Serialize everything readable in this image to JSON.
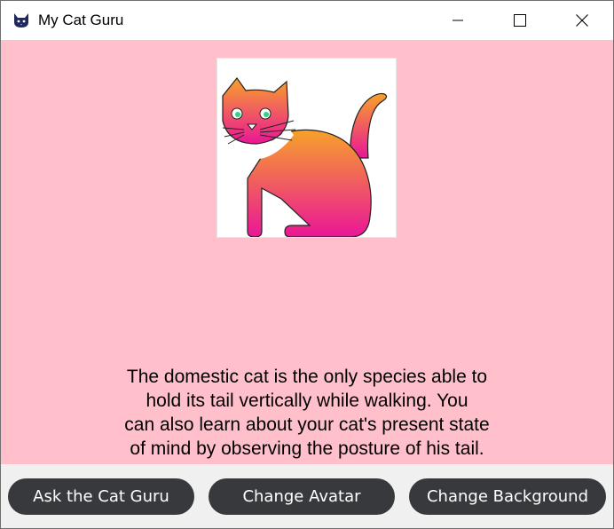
{
  "window": {
    "title": "My Cat Guru",
    "app_icon": "cat-face-icon",
    "controls": [
      "minimize-icon",
      "maximize-icon",
      "close-icon"
    ]
  },
  "colors": {
    "background": "#ffc0cb",
    "button": "#37393c",
    "button_text": "#ffffff",
    "cat_gradient_top": "#f7a22a",
    "cat_gradient_bottom": "#ea1697"
  },
  "avatar": {
    "icon": "orange-pink-cat-avatar"
  },
  "fact": {
    "text": "The domestic cat is the only species able to\nhold its tail vertically while walking. You\ncan also learn about your cat's present state\nof mind by observing the posture of his tail."
  },
  "buttons": {
    "ask": "Ask the Cat Guru",
    "avatar": "Change Avatar",
    "background": "Change Background"
  }
}
